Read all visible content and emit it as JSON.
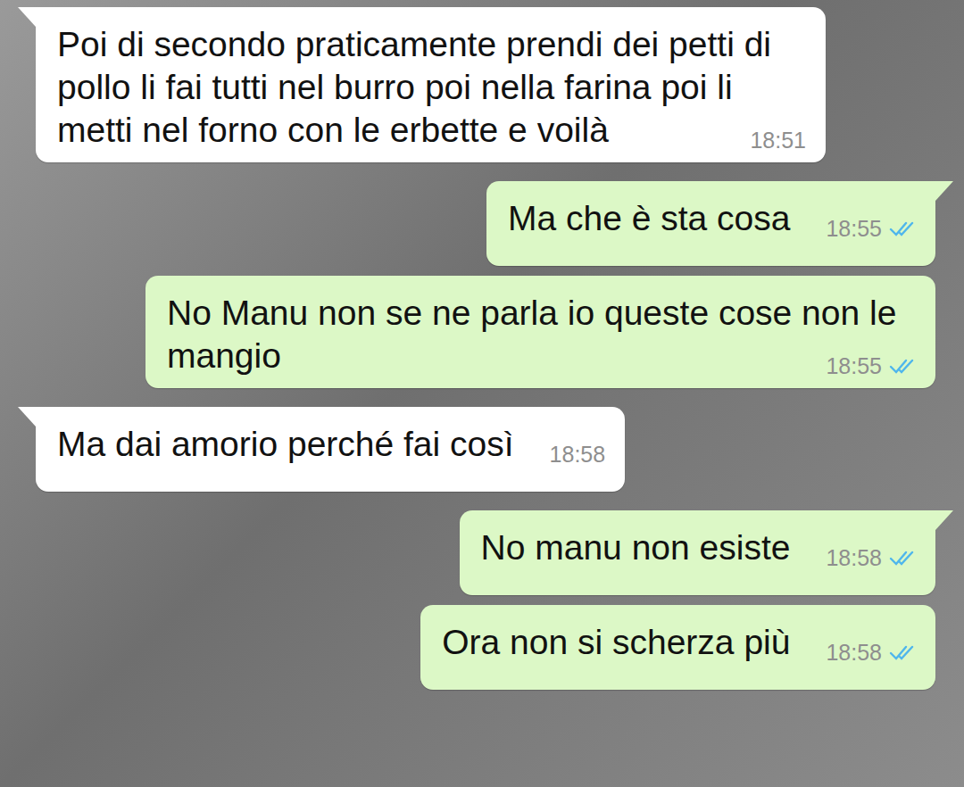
{
  "chat": {
    "messages": [
      {
        "kind": "incoming",
        "text": "Poi di secondo praticamente prendi dei petti di pollo li fai tutti nel burro poi nella farina poi li metti nel forno con le erbette e voilà",
        "time": "18:51",
        "tail": true
      },
      {
        "kind": "outgoing",
        "text": "Ma che è sta cosa",
        "time": "18:55",
        "tail": true,
        "read": true
      },
      {
        "kind": "outgoing",
        "text": "No Manu non se ne parla io queste cose non le mangio",
        "time": "18:55",
        "tail": false,
        "read": true
      },
      {
        "kind": "incoming",
        "text": "Ma dai amorio perché fai così",
        "time": "18:58",
        "tail": true
      },
      {
        "kind": "outgoing",
        "text": "No manu non esiste",
        "time": "18:58",
        "tail": true,
        "read": true
      },
      {
        "kind": "outgoing",
        "text": "Ora non si scherza più",
        "time": "18:58",
        "tail": false,
        "read": true
      }
    ]
  }
}
